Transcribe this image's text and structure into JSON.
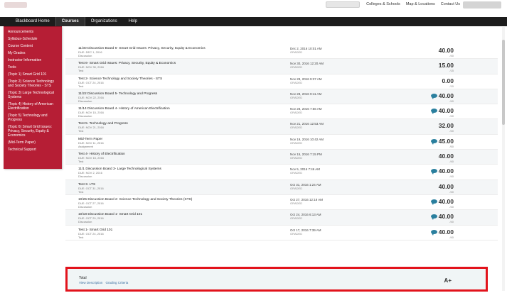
{
  "toplinks": [
    "Colleges & Schools",
    "Map & Locations",
    "Contact Us"
  ],
  "nav": {
    "items": [
      {
        "label": "Blackboard Home",
        "active": false
      },
      {
        "label": "Courses",
        "active": true
      },
      {
        "label": "Organizations",
        "active": false
      },
      {
        "label": "Help",
        "active": false
      }
    ]
  },
  "side_menu": [
    "Announcements",
    "Syllabus-Schedule",
    "Course Content",
    "My Grades",
    "Instructor Information",
    "Tools",
    "(Topic 1) Smart Grid 101",
    "(Topic 2) Science Technology and Society Theories - STS",
    "(Topic 3) Large Technological Systems",
    "(Topic 4) History of American Electrification",
    "(Topic 5) Technology and Progress",
    "(Topic 6) Smart Grid Issues: Privacy, Security, Equity & Economics",
    "(Mid-Term Paper)",
    "Technical Support"
  ],
  "grades": [
    {
      "title": "11/30 Discussion Board 6- Smart Grid Issues: Privacy, Security, Equity & Economics",
      "due": "DUE: DEC 1, 2016",
      "type": "Discussion",
      "date": "Dec 2, 2016 10:01 AM",
      "status": "GRADED",
      "score": "40.00",
      "possible": "/40",
      "comment": false
    },
    {
      "title": "Test 6- Smart Grid Issues: Privacy, Security, Equity & Economics",
      "due": "DUE: NOV 30, 2016",
      "type": "Test",
      "date": "Nov 30, 2016 12:20 AM",
      "status": "GRADED",
      "score": "15.00",
      "possible": "/15",
      "comment": false
    },
    {
      "title": "Test 2- Science Technology and Society Theories - STS",
      "due": "DUE: OCT 24, 2016",
      "type": "Test",
      "date": "Nov 28, 2016 9:37 AM",
      "status": "GRADED",
      "score": "0.00",
      "possible": "/10",
      "comment": false
    },
    {
      "title": "11/22 Discussion Board 5- Technology and Progress",
      "due": "DUE: NOV 22, 2016",
      "type": "Discussion",
      "date": "Nov 28, 2016 9:11 AM",
      "status": "GRADED",
      "score": "40.00",
      "possible": "/40",
      "comment": true
    },
    {
      "title": "11/14 Discussion Board 4- History of American Electrification",
      "due": "DUE: NOV 15, 2016",
      "type": "Discussion",
      "date": "Nov 28, 2016 7:56 AM",
      "status": "GRADED",
      "score": "40.00",
      "possible": "/40",
      "comment": true
    },
    {
      "title": "Test 5- Technology and Progress",
      "due": "DUE: NOV 21, 2016",
      "type": "Test",
      "date": "Nov 21, 2016 12:53 AM",
      "status": "GRADED",
      "score": "32.00",
      "possible": "/40",
      "comment": false
    },
    {
      "title": "Mid-Term Paper",
      "due": "DUE: NOV 11, 2016",
      "type": "Assignment",
      "date": "Nov 19, 2016 10:42 AM",
      "status": "GRADED",
      "score": "45.00",
      "possible": "/50",
      "comment": true
    },
    {
      "title": "Test 4- History of Electrification",
      "due": "DUE: NOV 15, 2016",
      "type": "Test",
      "date": "Nov 15, 2016 7:15 PM",
      "status": "GRADED",
      "score": "40.00",
      "possible": "/40",
      "comment": false
    },
    {
      "title": "11/1 Discussion Board 3- Large Technological Systems",
      "due": "DUE: NOV 2, 2016",
      "type": "Discussion",
      "date": "Nov 5, 2016 7:46 AM",
      "status": "GRADED",
      "score": "40.00",
      "possible": "/40",
      "comment": true
    },
    {
      "title": "Test 3- LTS",
      "due": "DUE: OCT 31, 2016",
      "type": "Test",
      "date": "Oct 31, 2016 1:24 AM",
      "status": "GRADED",
      "score": "40.00",
      "possible": "/40",
      "comment": false
    },
    {
      "title": "10/25 Discussion Board 2- Science Technology and Society Theories (STS)",
      "due": "DUE: OCT 27, 2016",
      "type": "Discussion",
      "date": "Oct 27, 2016 12:18 AM",
      "status": "GRADED",
      "score": "40.00",
      "possible": "/40",
      "comment": true
    },
    {
      "title": "10/18 Discussion Board 1- Smart Grid 101",
      "due": "DUE: OCT 20, 2016",
      "type": "Discussion",
      "date": "Oct 24, 2016 6:13 AM",
      "status": "GRADED",
      "score": "40.00",
      "possible": "/40",
      "comment": true
    },
    {
      "title": "Test 1- Smart Grid 101",
      "due": "DUE: OCT 24, 2016",
      "type": "Test",
      "date": "Oct 17, 2016 7:39 AM",
      "status": "GRADED",
      "score": "40.00",
      "possible": "/40",
      "comment": true
    }
  ],
  "total": {
    "label": "Total",
    "links": [
      "View Description",
      "Grading Criteria"
    ],
    "grade": "A+"
  },
  "colors": {
    "menu_bg": "#b61e35",
    "nav_bg": "#1c1c1c",
    "highlight_border": "#e2131c",
    "comment_icon": "#2a7f9e"
  }
}
